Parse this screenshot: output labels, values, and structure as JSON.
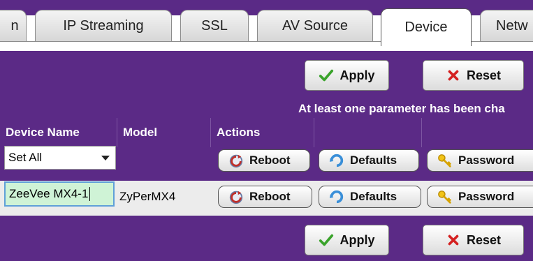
{
  "tabs": [
    {
      "label": "n"
    },
    {
      "label": "IP Streaming"
    },
    {
      "label": "SSL"
    },
    {
      "label": "AV Source"
    },
    {
      "label": "Device"
    },
    {
      "label": "Netw"
    }
  ],
  "active_tab": "Device",
  "toolbar": {
    "apply_label": "Apply",
    "reset_label": "Reset",
    "changed_note": "At least one parameter has been cha"
  },
  "table": {
    "headers": [
      "Device Name",
      "Model",
      "Actions"
    ],
    "set_all_row": {
      "select_value": "Set All",
      "reboot_label": "Reboot",
      "defaults_label": "Defaults",
      "password_label": "Password"
    },
    "device_row": {
      "name_value": "ZeeVee MX4-1",
      "model": "ZyPerMX4",
      "reboot_label": "Reboot",
      "defaults_label": "Defaults",
      "password_label": "Password"
    }
  },
  "icons": {
    "apply": "checkmark-icon",
    "reset": "x-icon",
    "reboot": "reboot-icon",
    "defaults": "defaults-icon",
    "password": "key-icon"
  },
  "colors": {
    "panel": "#5b2a86",
    "check": "#3aa32b",
    "cross": "#d42020"
  }
}
